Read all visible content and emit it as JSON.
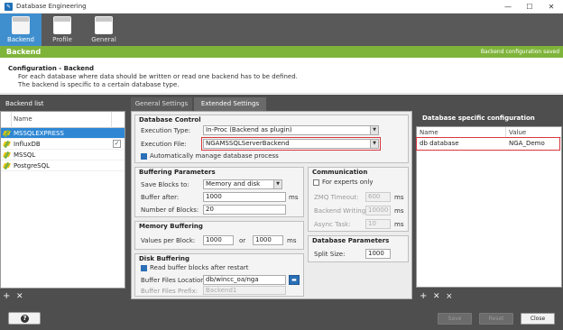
{
  "window": {
    "title": "Database Engineering",
    "app_icon": "✎",
    "controls": [
      "—",
      "☐",
      "✕"
    ]
  },
  "module_tabs": [
    {
      "label": "Backend",
      "active": true
    },
    {
      "label": "Profile",
      "active": false
    },
    {
      "label": "General",
      "active": false
    }
  ],
  "header": {
    "title": "Backend",
    "status": "Backend configuration saved",
    "color": "#7fb43a"
  },
  "info": {
    "heading": "Configuration - Backend",
    "line1": "For each database where data should be written or read one backend has to be defined.",
    "line2": "The backend is specific to a certain database type."
  },
  "backend_list": {
    "title": "Backend list",
    "column_name": "Name",
    "items": [
      {
        "name": "MSSQLEXPRESS",
        "selected": true,
        "checked": false
      },
      {
        "name": "InfluxDB",
        "selected": false,
        "checked": true
      },
      {
        "name": "MSSQL",
        "selected": false,
        "checked": false
      },
      {
        "name": "PostgreSQL",
        "selected": false,
        "checked": false
      }
    ],
    "toolbar": {
      "add": "+",
      "remove": "✕"
    }
  },
  "center_tabs": {
    "general": "General Settings",
    "extended": "Extended Settings",
    "active": "extended"
  },
  "database_control": {
    "title": "Database Control",
    "execution_type_label": "Execution Type:",
    "execution_type_value": "In-Proc (Backend as plugin)",
    "execution_file_label": "Execution File:",
    "execution_file_value": "NGAMSSQLServerBackend",
    "auto_manage_label": "Automatically manage database process",
    "auto_manage_checked": true
  },
  "buffering": {
    "title": "Buffering Parameters",
    "save_blocks_label": "Save Blocks to:",
    "save_blocks_value": "Memory and disk",
    "buffer_after_label": "Buffer after:",
    "buffer_after_value": "1000",
    "buffer_after_unit": "ms",
    "num_blocks_label": "Number of Blocks:",
    "num_blocks_value": "20"
  },
  "communication": {
    "title": "Communication",
    "experts_label": "For experts only",
    "experts_checked": false,
    "zmq_timeout_label": "ZMQ Timeout:",
    "zmq_timeout_value": "600",
    "backend_writing_label": "Backend Writing:",
    "backend_writing_value": "10000",
    "async_task_label": "Async Task:",
    "async_task_value": "10",
    "unit": "ms"
  },
  "memory_buffering": {
    "title": "Memory Buffering",
    "values_label": "Values per Block:",
    "value_a": "1000",
    "or_label": "or",
    "value_b": "1000",
    "unit": "ms"
  },
  "database_parameters": {
    "title": "Database Parameters",
    "split_size_label": "Split Size:",
    "split_size_value": "1000"
  },
  "disk_buffering": {
    "title": "Disk Buffering",
    "read_after_restart_label": "Read buffer blocks after restart",
    "read_after_restart_checked": true,
    "location_label": "Buffer Files Location:",
    "location_value": "db/wincc_oa/nga",
    "prefix_label": "Buffer Files Prefix:",
    "prefix_value": "Backend1"
  },
  "db_config": {
    "title": "Database specific configuration",
    "col_name": "Name",
    "col_value": "Value",
    "rows": [
      {
        "name": "db database",
        "value": "NGA_Demo"
      }
    ],
    "toolbar": {
      "add": "+",
      "remove": "✕",
      "clear": "⨯"
    }
  },
  "footer": {
    "help_icon": "?",
    "save": "Save",
    "reset": "Reset",
    "close": "Close"
  }
}
